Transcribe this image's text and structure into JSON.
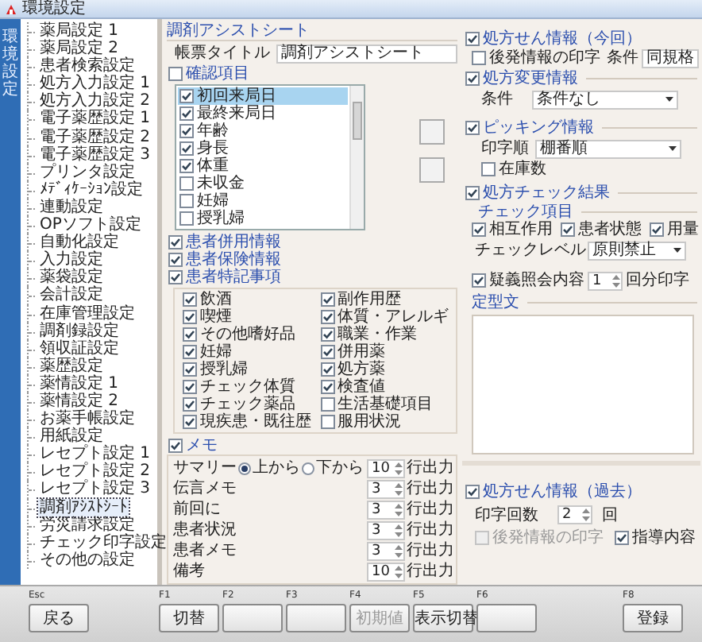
{
  "window": {
    "title": "環境設定"
  },
  "side_tab": {
    "label": "環境設定"
  },
  "sidebar": {
    "items": [
      {
        "label": "薬局設定 1",
        "selected": false
      },
      {
        "label": "薬局設定 2",
        "selected": false
      },
      {
        "label": "患者検索設定",
        "selected": false
      },
      {
        "label": "処方入力設定 1",
        "selected": false
      },
      {
        "label": "処方入力設定 2",
        "selected": false
      },
      {
        "label": "電子薬歴設定 1",
        "selected": false
      },
      {
        "label": "電子薬歴設定 2",
        "selected": false
      },
      {
        "label": "電子薬歴設定 3",
        "selected": false
      },
      {
        "label": "プリンタ設定",
        "selected": false
      },
      {
        "label": "ﾒﾃﾞｨｹｰｼｮﾝ設定",
        "selected": false
      },
      {
        "label": "連動設定",
        "selected": false
      },
      {
        "label": "OPソフト設定",
        "selected": false
      },
      {
        "label": "自動化設定",
        "selected": false
      },
      {
        "label": "入力設定",
        "selected": false
      },
      {
        "label": "薬袋設定",
        "selected": false
      },
      {
        "label": "会計設定",
        "selected": false
      },
      {
        "label": "在庫管理設定",
        "selected": false
      },
      {
        "label": "調剤録設定",
        "selected": false
      },
      {
        "label": "領収証設定",
        "selected": false
      },
      {
        "label": "薬歴設定",
        "selected": false
      },
      {
        "label": "薬情設定 1",
        "selected": false
      },
      {
        "label": "薬情設定 2",
        "selected": false
      },
      {
        "label": "お薬手帳設定",
        "selected": false
      },
      {
        "label": "用紙設定",
        "selected": false
      },
      {
        "label": "レセプト設定 1",
        "selected": false
      },
      {
        "label": "レセプト設定 2",
        "selected": false
      },
      {
        "label": "レセプト設定 3",
        "selected": false
      },
      {
        "label": "調剤ｱｼｽﾄｼｰﾄ",
        "selected": true
      },
      {
        "label": "労災請求設定",
        "selected": false
      },
      {
        "label": "チェック印字設定",
        "selected": false
      },
      {
        "label": "その他の設定",
        "selected": false
      }
    ]
  },
  "assist": {
    "title": "調剤アシストシート",
    "form_title": {
      "label": "帳票タイトル",
      "value": "調剤アシストシート"
    },
    "confirm": {
      "label": "確認項目",
      "checked": false,
      "items": [
        {
          "label": "初回来局日",
          "checked": true,
          "selected": true
        },
        {
          "label": "最終来局日",
          "checked": true,
          "selected": false
        },
        {
          "label": "年齢",
          "checked": true,
          "selected": false
        },
        {
          "label": "身長",
          "checked": true,
          "selected": false
        },
        {
          "label": "体重",
          "checked": true,
          "selected": false
        },
        {
          "label": "未収金",
          "checked": false,
          "selected": false
        },
        {
          "label": "妊婦",
          "checked": false,
          "selected": false
        },
        {
          "label": "授乳婦",
          "checked": false,
          "selected": false
        }
      ]
    },
    "patient_info": [
      {
        "label": "患者併用情報",
        "checked": true
      },
      {
        "label": "患者保険情報",
        "checked": true
      },
      {
        "label": "患者特記事項",
        "checked": true
      }
    ],
    "notes": [
      {
        "label": "飲酒",
        "checked": true
      },
      {
        "label": "副作用歴",
        "checked": true
      },
      {
        "label": "喫煙",
        "checked": true
      },
      {
        "label": "体質・アレルギ",
        "checked": true
      },
      {
        "label": "その他嗜好品",
        "checked": true
      },
      {
        "label": "職業・作業",
        "checked": true
      },
      {
        "label": "妊婦",
        "checked": true
      },
      {
        "label": "併用薬",
        "checked": true
      },
      {
        "label": "授乳婦",
        "checked": true
      },
      {
        "label": "処方薬",
        "checked": true
      },
      {
        "label": "チェック体質",
        "checked": true
      },
      {
        "label": "検査値",
        "checked": true
      },
      {
        "label": "チェック薬品",
        "checked": true
      },
      {
        "label": "生活基礎項目",
        "checked": false
      },
      {
        "label": "現疾患・既往歴",
        "checked": true
      },
      {
        "label": "服用状況",
        "checked": false
      }
    ],
    "memo": {
      "label": "メモ",
      "checked": true,
      "summary": {
        "label": "サマリー",
        "options": [
          {
            "label": "上から",
            "selected": true
          },
          {
            "label": "下から",
            "selected": false
          }
        ],
        "value": "10",
        "unit": "行出力"
      },
      "rows": [
        {
          "label": "伝言メモ",
          "value": "3",
          "unit": "行出力"
        },
        {
          "label": "前回に",
          "value": "3",
          "unit": "行出力"
        },
        {
          "label": "患者状況",
          "value": "3",
          "unit": "行出力"
        },
        {
          "label": "患者メモ",
          "value": "3",
          "unit": "行出力"
        },
        {
          "label": "備考",
          "value": "10",
          "unit": "行出力"
        }
      ]
    }
  },
  "rx_current": {
    "label": "処方せん情報（今回）",
    "checked": true,
    "generic": {
      "label": "後発情報の印字",
      "checked": false,
      "condition_label": "条件",
      "condition_value": "同規格"
    },
    "change": {
      "label": "処方変更情報",
      "checked": true,
      "field_label": "条件",
      "value": "条件なし"
    },
    "picking": {
      "label": "ピッキング情報",
      "checked": true,
      "field_label": "印字順",
      "value": "棚番順",
      "stock": {
        "label": "在庫数",
        "checked": false
      }
    },
    "check_result": {
      "label": "処方チェック結果",
      "checked": true,
      "items_label": "チェック項目",
      "items": [
        {
          "label": "相互作用",
          "checked": true
        },
        {
          "label": "患者状態",
          "checked": true
        },
        {
          "label": "用量",
          "checked": true
        }
      ],
      "level_label": "チェックレベル",
      "level_value": "原則禁止"
    },
    "inquiry": {
      "label": "疑義照会内容",
      "checked": true,
      "value": "1",
      "unit": "回分印字"
    },
    "template": {
      "label": "定型文"
    }
  },
  "rx_past": {
    "label": "処方せん情報（過去）",
    "checked": true,
    "count_label": "印字回数",
    "count": "2",
    "count_unit": "回",
    "options": [
      {
        "label": "後発情報の印字",
        "checked": false,
        "disabled": true
      },
      {
        "label": "指導内容",
        "checked": true,
        "disabled": false
      }
    ]
  },
  "footer": {
    "left": [
      {
        "key": "Esc",
        "label": "戻る",
        "disabled": false
      }
    ],
    "middle": [
      {
        "key": "F1",
        "label": "切替",
        "disabled": false
      },
      {
        "key": "F2"
      },
      {
        "key": "F3"
      },
      {
        "key": "F4",
        "label": "初期値",
        "disabled": true
      },
      {
        "key": "F5",
        "label": "表示切替",
        "disabled": false
      },
      {
        "key": "F6"
      }
    ],
    "right": [
      {
        "key": "F8",
        "label": "登録",
        "disabled": false
      }
    ]
  }
}
